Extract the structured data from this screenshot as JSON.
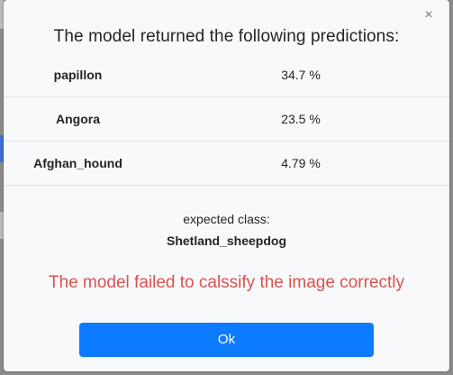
{
  "dialog": {
    "title": "The model returned the following predictions:",
    "close_icon": "×",
    "predictions": [
      {
        "label": "papillon",
        "value": "34.7 %"
      },
      {
        "label": "Angora",
        "value": "23.5 %"
      },
      {
        "label": "Afghan_hound",
        "value": "4.79 %"
      }
    ],
    "expected_label": "expected class:",
    "expected_value": "Shetland_sheepdog",
    "failure_message": "The model failed to calssify the image correctly",
    "ok_label": "Ok"
  },
  "colors": {
    "primary": "#0d7bff",
    "danger": "#d9534f",
    "modal_bg": "#f8f9fb"
  },
  "icons": {
    "close": "close-icon"
  }
}
